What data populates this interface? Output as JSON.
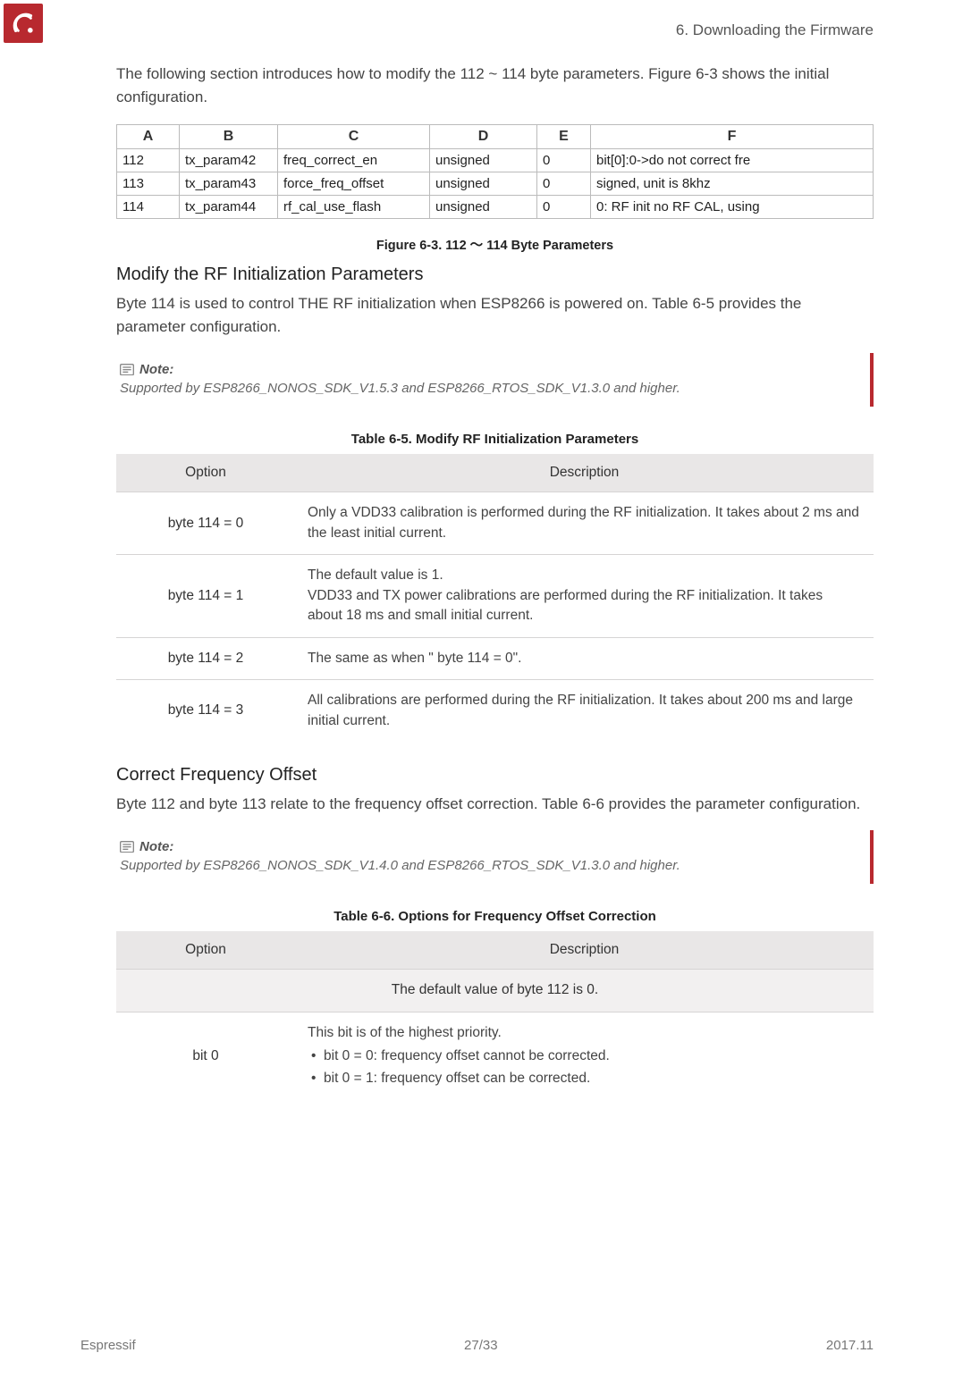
{
  "header": {
    "chapter": "6. Downloading the Firmware"
  },
  "intro": "The following section introduces how to modify the 112 ~ 114 byte parameters. Figure 6-3 shows the initial configuration.",
  "spreadsheet": {
    "headers": {
      "A": "A",
      "B": "B",
      "C": "C",
      "D": "D",
      "E": "E",
      "F": "F"
    },
    "rows": [
      {
        "A": "112",
        "B": "tx_param42",
        "C": "freq_correct_en",
        "D": "unsigned",
        "E": "0",
        "F": "bit[0]:0->do not correct fre"
      },
      {
        "A": "113",
        "B": "tx_param43",
        "C": "force_freq_offset",
        "D": "unsigned",
        "E": "0",
        "F": "signed, unit is 8khz"
      },
      {
        "A": "114",
        "B": "tx_param44",
        "C": "rf_cal_use_flash",
        "D": "unsigned",
        "E": "0",
        "F": "0: RF init no RF CAL, using"
      }
    ]
  },
  "fig63_caption": "Figure 6-3. 112 ～ 114 Byte Parameters",
  "section1": {
    "heading": "Modify the RF Initialization Parameters",
    "para": "Byte 114 is used to control THE RF initialization when ESP8266 is powered on. Table 6-5 provides the parameter configuration."
  },
  "note1": {
    "title": "Note:",
    "body": "Supported by ESP8266_NONOS_SDK_V1.5.3 and ESP8266_RTOS_SDK_V1.3.0 and higher."
  },
  "table65": {
    "caption": "Table 6-5. Modify RF Initialization Parameters",
    "head_option": "Option",
    "head_desc": "Description",
    "rows": [
      {
        "opt": "byte 114 = 0",
        "desc": "Only a VDD33 calibration is performed during the RF initialization. It takes about 2 ms and the least initial current."
      },
      {
        "opt": "byte 114 = 1",
        "desc": "The default value is 1.\nVDD33 and TX power calibrations are performed during the RF initialization. It takes about 18 ms and small initial current."
      },
      {
        "opt": "byte 114 = 2",
        "desc": "The same as when \" byte 114 = 0\"."
      },
      {
        "opt": "byte 114 = 3",
        "desc": "All calibrations are performed during the RF initialization. It takes about 200 ms and large initial current."
      }
    ]
  },
  "section2": {
    "heading": "Correct Frequency Offset",
    "para": "Byte 112 and byte 113 relate to the frequency offset correction. Table 6-6 provides the parameter configuration."
  },
  "note2": {
    "title": "Note:",
    "body": "Supported by ESP8266_NONOS_SDK_V1.4.0 and ESP8266_RTOS_SDK_V1.3.0 and higher."
  },
  "table66": {
    "caption": "Table 6-6. Options for Frequency Offset Correction",
    "head_option": "Option",
    "head_desc": "Description",
    "subhead": "The default value of byte 112 is 0.",
    "row1": {
      "opt": "bit 0",
      "desc_line": "This bit is of the highest priority.",
      "bullets": [
        "bit 0 = 0: frequency offset cannot be corrected.",
        "bit 0 = 1: frequency offset can be corrected."
      ]
    }
  },
  "footer": {
    "left": "Espressif",
    "center": "27/33",
    "right": "2017.11"
  }
}
